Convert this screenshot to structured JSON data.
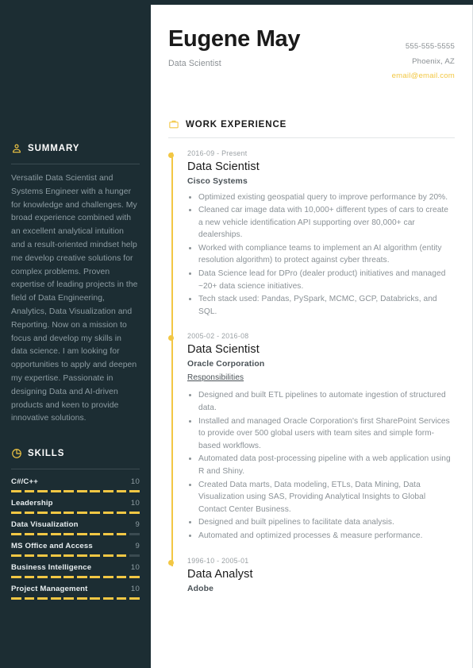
{
  "header": {
    "name": "Eugene May",
    "role": "Data Scientist",
    "phone": "555-555-5555",
    "location": "Phoenix, AZ",
    "email": "email@email.com"
  },
  "sidebar": {
    "summary": {
      "icon": "person-icon",
      "title": "SUMMARY",
      "text": "Versatile Data Scientist and Systems Engineer with a hunger for knowledge and challenges. My broad experience combined with an excellent analytical intuition and a result-oriented mindset help me develop creative solutions for complex problems. Proven expertise of leading projects in the field of Data Engineering, Analytics, Data Visualization and Reporting. Now on a mission to focus and develop my skills in data science. I am looking for opportunities to apply and deepen my expertise. Passionate in designing Data and AI-driven products and keen to provide innovative solutions."
    },
    "skills": {
      "icon": "pie-chart-icon",
      "title": "SKILLS",
      "max": 10,
      "items": [
        {
          "name": "C#/C++",
          "level": 10
        },
        {
          "name": "Leadership",
          "level": 10
        },
        {
          "name": "Data Visualization",
          "level": 9
        },
        {
          "name": "MS Office and Access",
          "level": 9
        },
        {
          "name": "Business Intelligence",
          "level": 10
        },
        {
          "name": "Project Management",
          "level": 10
        }
      ]
    }
  },
  "main": {
    "work": {
      "icon": "briefcase-icon",
      "title": "WORK EXPERIENCE",
      "jobs": [
        {
          "date": "2016-09 - Present",
          "title": "Data Scientist",
          "company": "Cisco Systems",
          "subheading": "",
          "bullets": [
            "Optimized existing geospatial query to improve performance by 20%.",
            "Cleaned car image data with 10,000+ different types of cars to create a new vehicle identification API supporting over 80,000+ car dealerships.",
            "Worked with compliance teams to implement an AI algorithm (entity resolution algorithm) to protect against cyber threats.",
            "Data Science lead for DPro (dealer product) initiatives and managed ~20+ data science initiatives.",
            "Tech stack used: Pandas, PySpark, MCMC, GCP, Databricks, and SQL."
          ]
        },
        {
          "date": "2005-02 - 2016-08",
          "title": "Data Scientist",
          "company": "Oracle Corporation",
          "subheading": "Responsibilities",
          "bullets": [
            "Designed and built ETL pipelines to automate ingestion of structured data.",
            "Installed and managed Oracle Corporation's first SharePoint Services to provide over 500 global users with team sites and simple form-based workflows.",
            "Automated data post-processing pipeline with a web application using R and Shiny.",
            "Created Data marts, Data modeling, ETLs, Data Mining, Data Visualization using SAS, Providing Analytical Insights to Global Contact Center Business.",
            "Designed and built pipelines to facilitate data analysis.",
            "Automated and optimized processes & measure performance."
          ]
        },
        {
          "date": "1996-10 - 2005-01",
          "title": "Data Analyst",
          "company": "Adobe",
          "subheading": "",
          "bullets": []
        }
      ]
    }
  },
  "colors": {
    "sidebar_bg": "#1c2d33",
    "accent": "#f2c744",
    "body_text": "#8a9196"
  }
}
